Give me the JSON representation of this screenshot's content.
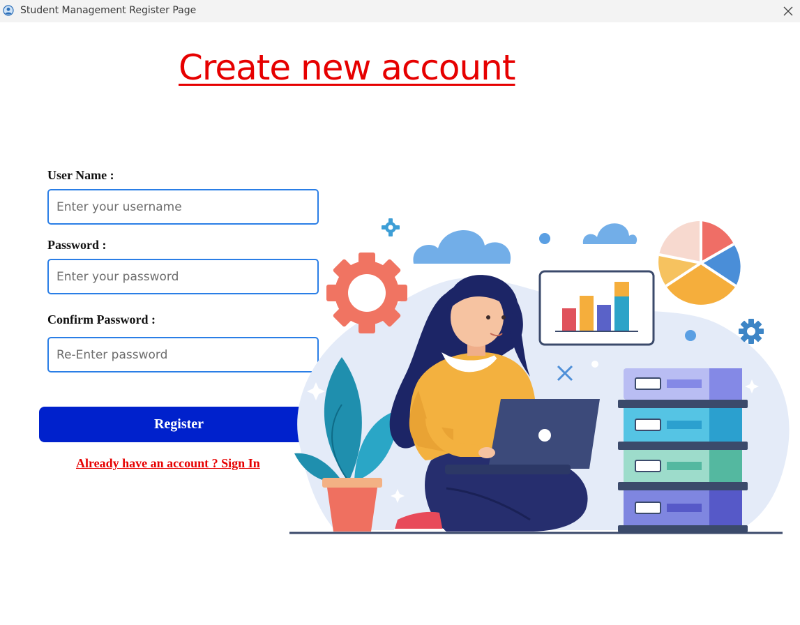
{
  "window": {
    "title": "Student Management Register Page",
    "icon": "user-circle-icon",
    "close_icon": "close-icon"
  },
  "heading": "Create new account",
  "form": {
    "username_label": "User Name :",
    "username_placeholder": "Enter your username",
    "username_value": "",
    "password_label": "Password :",
    "password_placeholder": "Enter your password",
    "password_value": "",
    "confirm_label": "Confirm Password :",
    "confirm_placeholder": "Re-Enter password",
    "confirm_value": "",
    "register_label": "Register",
    "signin_link": "Already have an account ? Sign In"
  },
  "colors": {
    "heading": "#e60000",
    "button": "#0021cc",
    "field_border": "#2a7ee6",
    "link": "#e60000"
  }
}
